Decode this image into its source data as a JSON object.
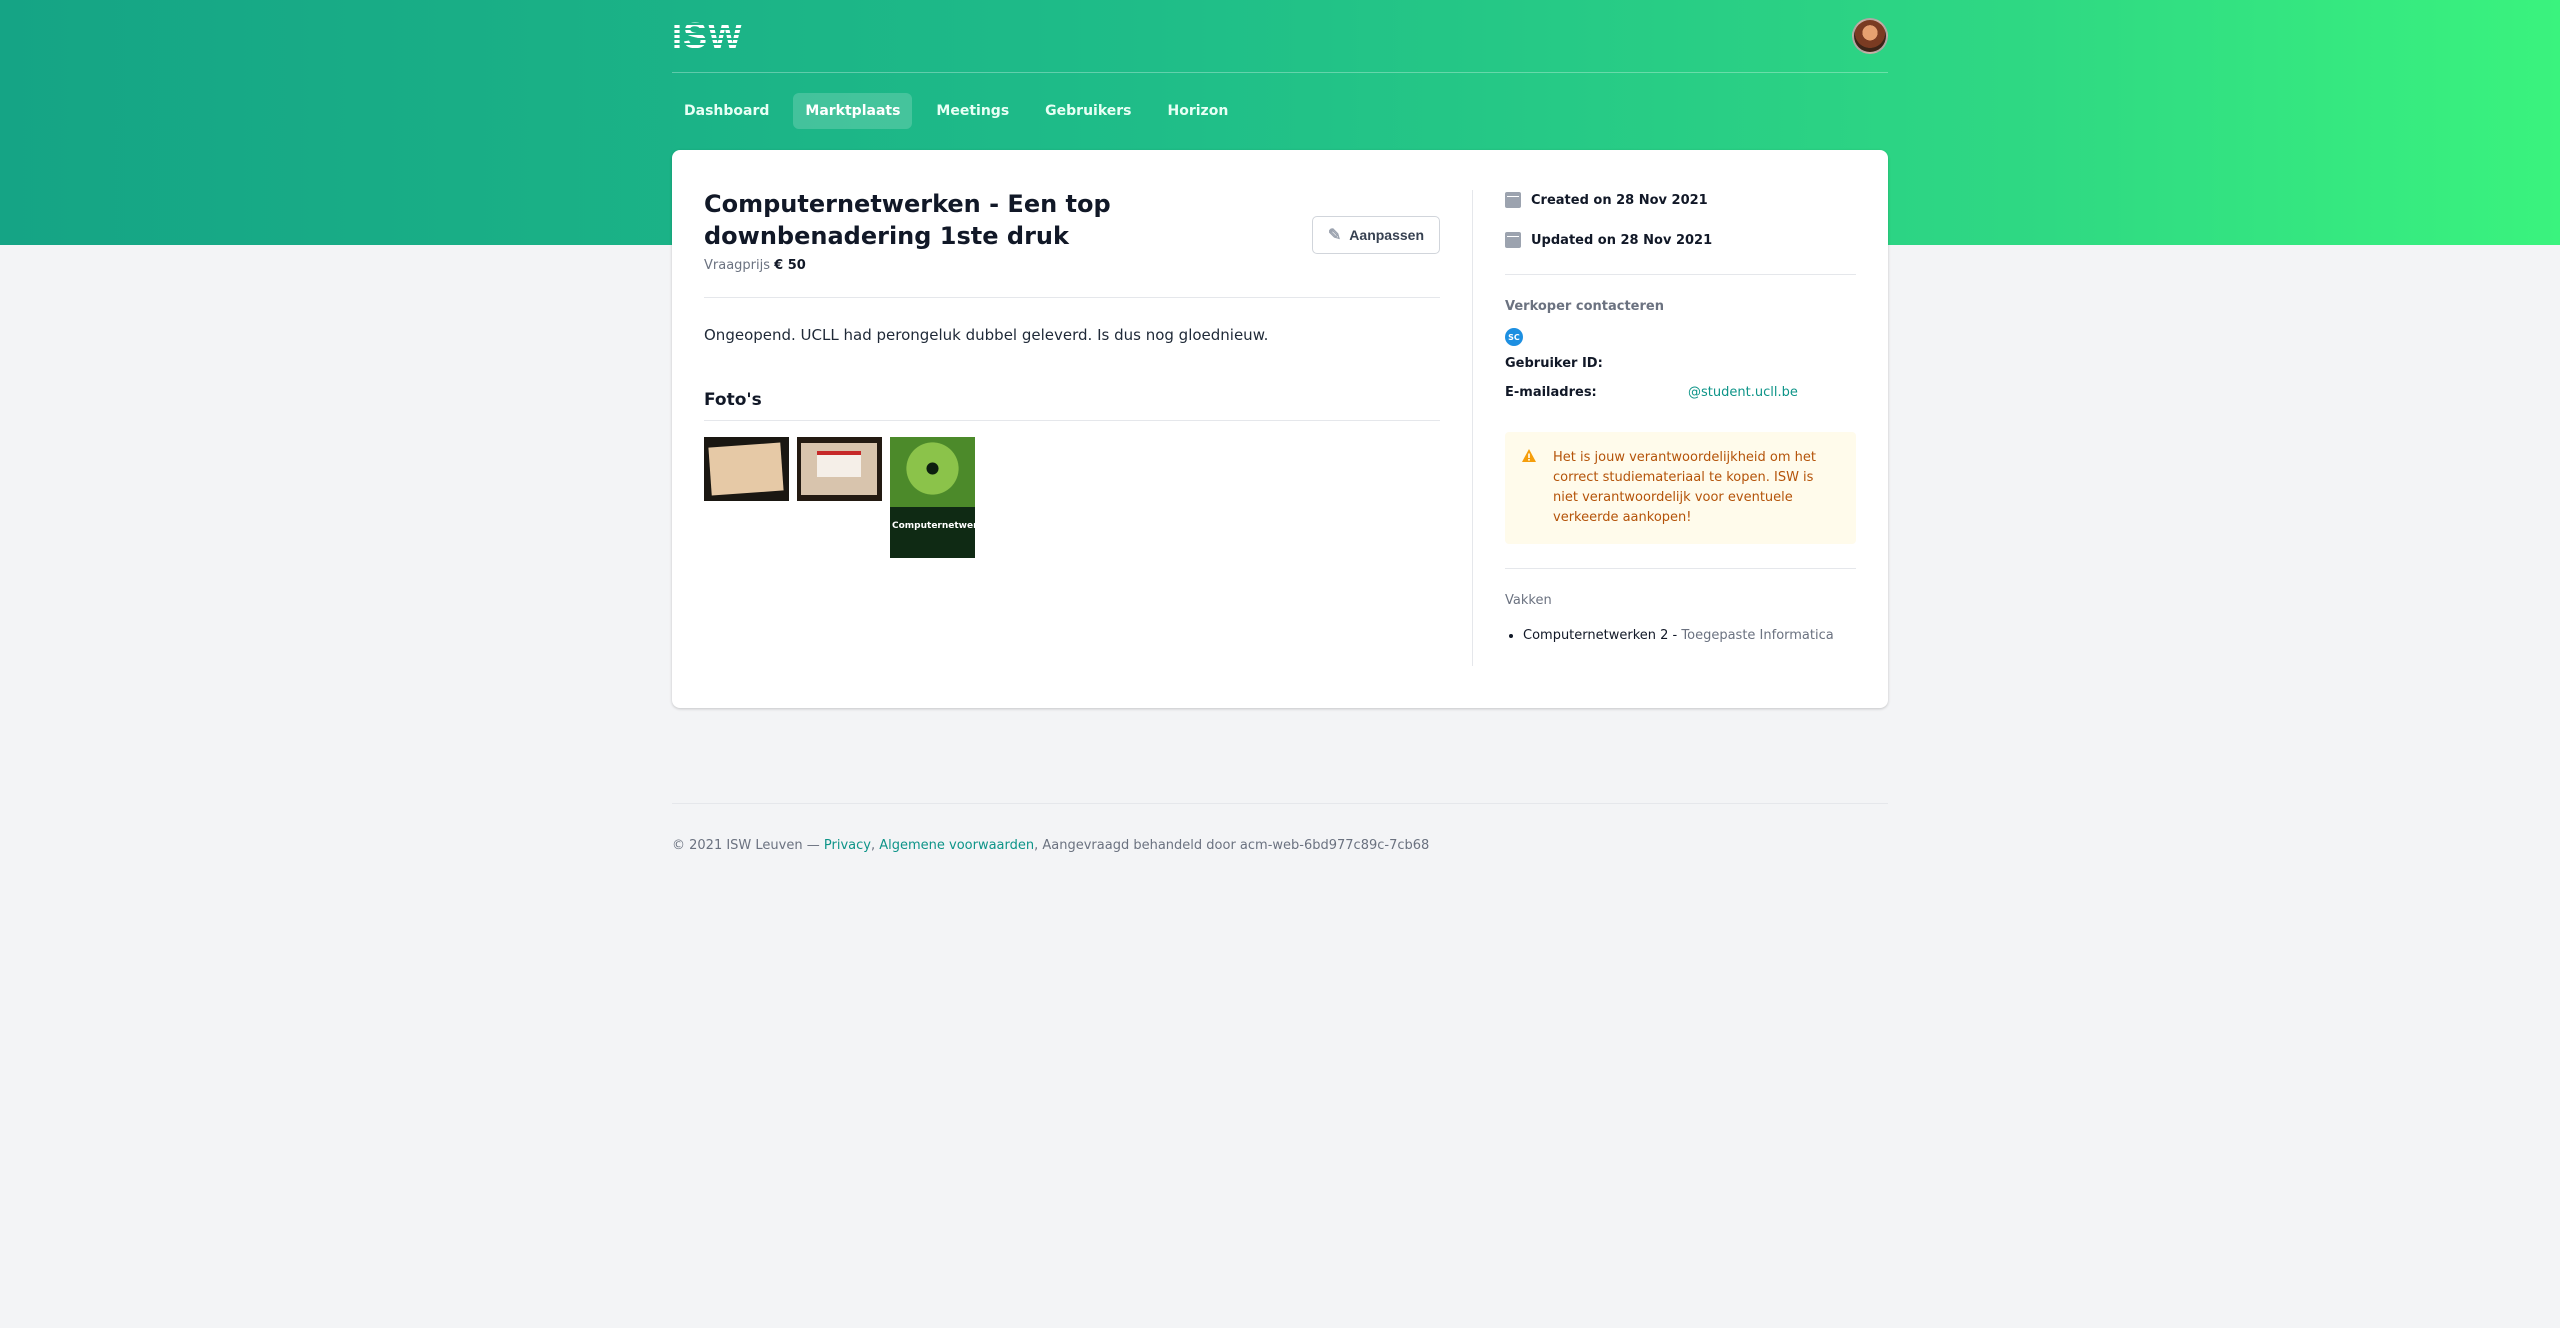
{
  "brand": {
    "logo_text": "ISW"
  },
  "nav": {
    "items": [
      {
        "label": "Dashboard",
        "active": false
      },
      {
        "label": "Marktplaats",
        "active": true
      },
      {
        "label": "Meetings",
        "active": false
      },
      {
        "label": "Gebruikers",
        "active": false
      },
      {
        "label": "Horizon",
        "active": false
      }
    ]
  },
  "listing": {
    "title": "Computernetwerken - Een top downbenadering 1ste druk",
    "price_label": "Vraagprijs",
    "price_value": "€ 50",
    "edit_label": "Aanpassen",
    "description": "Ongeopend. UCLL had perongeluk dubbel geleverd. Is dus nog gloednieuw.",
    "photos_heading": "Foto's"
  },
  "side": {
    "created": "Created on 28 Nov 2021",
    "updated": "Updated on 28 Nov 2021",
    "contact_heading": "Verkoper contacteren",
    "seller_initials": "SC",
    "user_id_label": "Gebruiker ID:",
    "user_id_value": "",
    "email_label": "E-mailadres:",
    "email_value": "@student.ucll.be",
    "warning": "Het is jouw verantwoordelijkheid om het correct studiemateriaal te kopen. ISW is niet verantwoordelijk voor eventuele verkeerde aankopen!",
    "courses_heading": "Vakken",
    "course_name": "Computernetwerken 2",
    "course_sep": " - ",
    "course_program": "Toegepaste Informatica"
  },
  "footer": {
    "copyright": "© 2021 ISW Leuven — ",
    "privacy": "Privacy",
    "comma": ", ",
    "terms": "Algemene voorwaarden",
    "handled": ", Aangevraagd behandeld door acm-web-6bd977c89c-7cb68"
  },
  "colors": {
    "accent": "#0d9488",
    "hero_start": "#15a485",
    "hero_end": "#3af37e",
    "warning_text": "#b45309",
    "warning_bg": "#fffbeb"
  },
  "icons": {
    "calendar": "calendar-icon",
    "edit": "pencil-icon",
    "warning": "warning-triangle-icon"
  }
}
